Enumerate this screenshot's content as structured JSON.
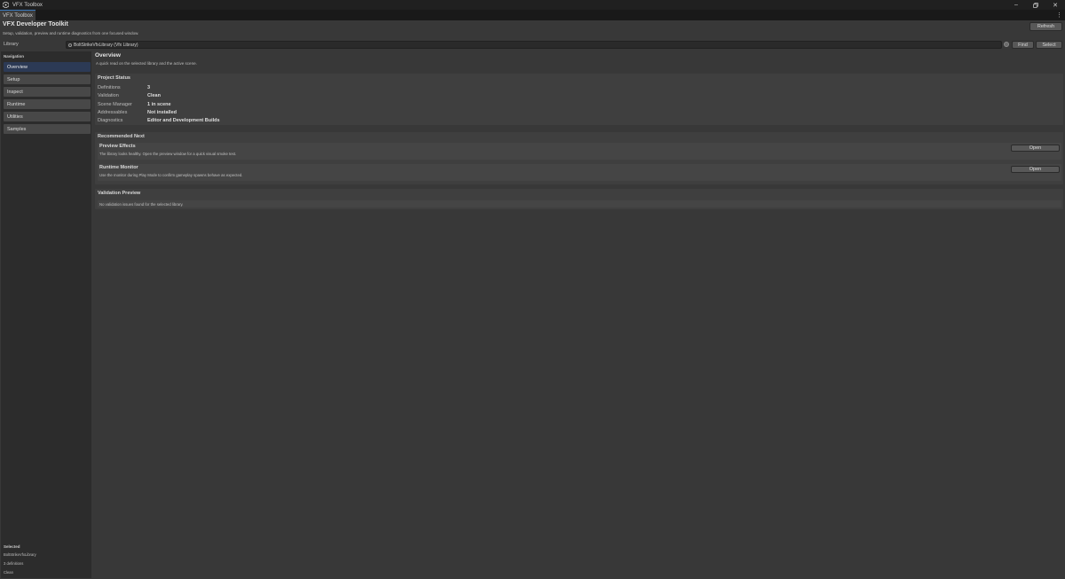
{
  "window": {
    "title": "VFX Toolbox",
    "tab_label": "VFX Toolbox"
  },
  "header": {
    "title": "VFX Developer Toolkit",
    "subtitle": "Setup, validation, preview and runtime diagnostics from one focused window.",
    "refresh_label": "Refresh"
  },
  "library": {
    "label": "Library",
    "value": "BoltStrikeVfxLibrary (Vfx Library)",
    "find_label": "Find",
    "select_label": "Select"
  },
  "sidebar": {
    "header": "Navigation",
    "items": [
      {
        "label": "Overview"
      },
      {
        "label": "Setup"
      },
      {
        "label": "Inspect"
      },
      {
        "label": "Runtime"
      },
      {
        "label": "Utilities"
      },
      {
        "label": "Samples"
      }
    ],
    "selected": {
      "header": "Selected",
      "name": "BoltStrikeVfxLibrary",
      "definitions": "3 definitions",
      "status": "Clean"
    }
  },
  "overview": {
    "title": "Overview",
    "subtitle": "A quick read on the selected library and the active scene."
  },
  "project_status": {
    "title": "Project Status",
    "rows": [
      {
        "key": "Definitions",
        "value": "3"
      },
      {
        "key": "Validation",
        "value": "Clean"
      },
      {
        "key": "Scene Manager",
        "value": "1 in scene"
      },
      {
        "key": "Addressables",
        "value": "Not installed"
      },
      {
        "key": "Diagnostics",
        "value": "Editor and Development Builds"
      }
    ]
  },
  "recommended": {
    "title": "Recommended Next",
    "items": [
      {
        "title": "Preview Effects",
        "desc": "The library looks healthy. Open the preview window for a quick visual smoke test.",
        "button": "Open"
      },
      {
        "title": "Runtime Monitor",
        "desc": "Use the monitor during Play Mode to confirm gameplay spawns behave as expected.",
        "button": "Open"
      }
    ]
  },
  "validation_preview": {
    "title": "Validation Preview",
    "message": "No validation issues found for the selected library."
  },
  "colors": {
    "accent": "#3a79bb",
    "active_nav": "#2c3a55",
    "background": "#383838"
  }
}
